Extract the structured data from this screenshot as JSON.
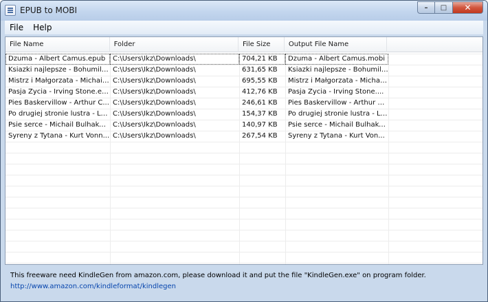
{
  "window": {
    "title": "EPUB to MOBI"
  },
  "controls": {
    "minimize": "–",
    "maximize": "□",
    "close": "✕"
  },
  "menu": [
    {
      "label": "File"
    },
    {
      "label": "Help"
    }
  ],
  "table": {
    "columns": [
      "File Name",
      "Folder",
      "File Size",
      "Output File Name"
    ],
    "rows": [
      [
        "Dzuma - Albert Camus.epub",
        "C:\\Users\\Ikz\\Downloads\\",
        "704,21 KB",
        "Dzuma - Albert Camus.mobi"
      ],
      [
        "Ksiazki najlepsze - Bohumil H...",
        "C:\\Users\\Ikz\\Downloads\\",
        "631,65 KB",
        "Ksiazki najlepsze - Bohumil ..."
      ],
      [
        "Mistrz i Małgorzata - Michaił B...",
        "C:\\Users\\Ikz\\Downloads\\",
        "695,55 KB",
        "Mistrz i Małgorzata - Michaił ..."
      ],
      [
        "Pasja Zycia - Irving Stone.ep...",
        "C:\\Users\\Ikz\\Downloads\\",
        "412,76 KB",
        "Pasja Zycia - Irving Stone...."
      ],
      [
        "Pies Baskervillow - Arthur C...",
        "C:\\Users\\Ikz\\Downloads\\",
        "246,61 KB",
        "Pies Baskervillow - Arthur C..."
      ],
      [
        "Po drugiej stronie lustra - Le...",
        "C:\\Users\\Ikz\\Downloads\\",
        "154,37 KB",
        "Po drugiej stronie lustra - Le..."
      ],
      [
        "Psie serce - Michail Bulhakow...",
        "C:\\Users\\Ikz\\Downloads\\",
        "140,97 KB",
        "Psie serce - Michail Bulhako..."
      ],
      [
        "Syreny z Tytana - Kurt Vonn...",
        "C:\\Users\\Ikz\\Downloads\\",
        "267,54 KB",
        "Syreny z Tytana - Kurt Von..."
      ]
    ]
  },
  "footer": {
    "message": "This freeware need KindleGen from amazon.com, please download it and put the file \"KindleGen.exe\" on program folder.",
    "link": "http://www.amazon.com/kindleformat/kindlegen"
  },
  "colors": {
    "link": "#0645ad",
    "frame": "#c9d9ec"
  }
}
